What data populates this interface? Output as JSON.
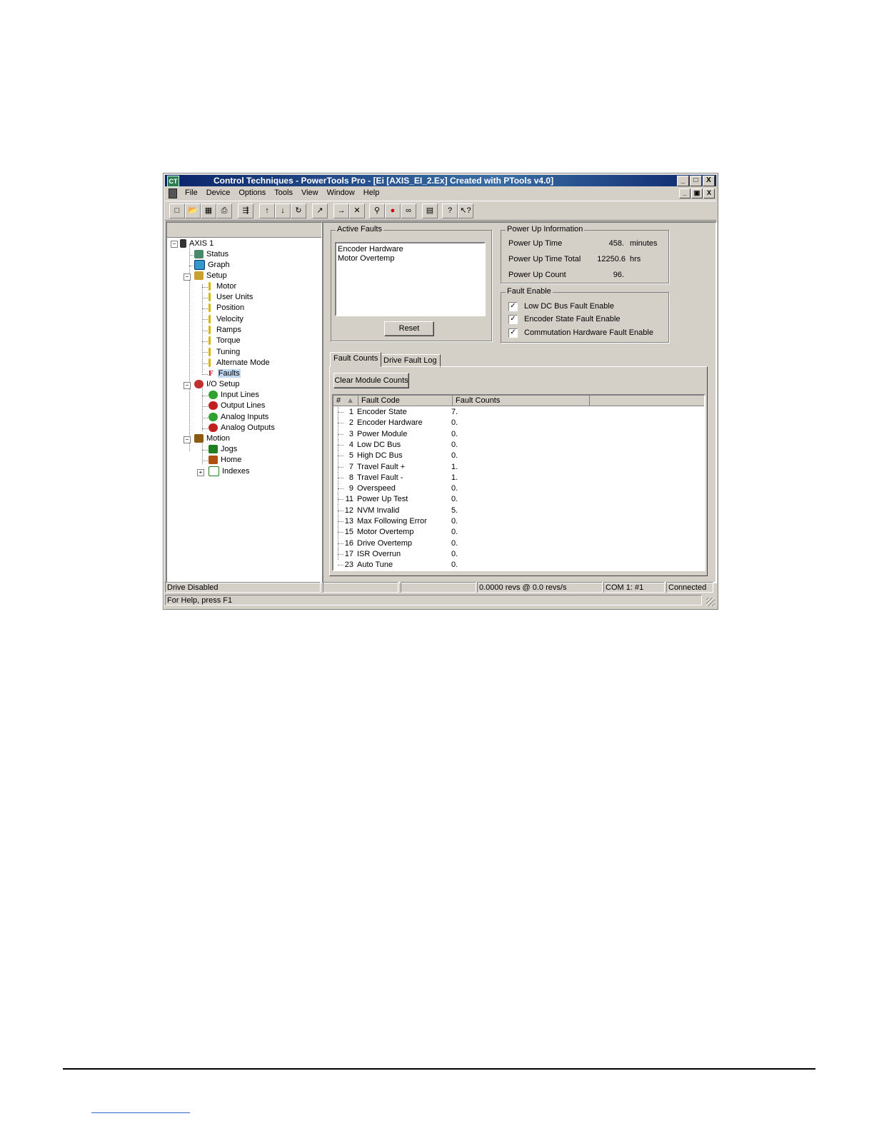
{
  "window": {
    "title": "Control Techniques - PowerTools Pro - [Ei  [AXIS_EI_2.Ex] Created with PTools v4.0]",
    "caption_buttons": [
      "_",
      "□",
      "X"
    ],
    "mdi_buttons": [
      "_",
      "▣",
      "X"
    ]
  },
  "menu": [
    "File",
    "Device",
    "Options",
    "Tools",
    "View",
    "Window",
    "Help"
  ],
  "toolbar_icons": [
    "new-icon",
    "open-icon",
    "save-icon",
    "print-icon",
    "export-icon",
    "upload-icon",
    "download-icon",
    "refresh-icon",
    "connect-icon",
    "transfer-icon",
    "disconnect-icon",
    "search-icon",
    "stop-icon",
    "view-icon",
    "window-icon",
    "help-icon",
    "context-help-icon"
  ],
  "tree": {
    "root": "AXIS 1",
    "items": [
      {
        "label": "Status"
      },
      {
        "label": "Graph"
      },
      {
        "label": "Setup"
      },
      {
        "label": "Motor"
      },
      {
        "label": "User Units"
      },
      {
        "label": "Position"
      },
      {
        "label": "Velocity"
      },
      {
        "label": "Ramps"
      },
      {
        "label": "Torque"
      },
      {
        "label": "Tuning"
      },
      {
        "label": "Alternate Mode"
      },
      {
        "label": "Faults"
      },
      {
        "label": "I/O Setup"
      },
      {
        "label": "Input Lines"
      },
      {
        "label": "Output Lines"
      },
      {
        "label": "Analog Inputs"
      },
      {
        "label": "Analog Outputs"
      },
      {
        "label": "Motion"
      },
      {
        "label": "Jogs"
      },
      {
        "label": "Home"
      },
      {
        "label": "Indexes"
      }
    ]
  },
  "active_faults": {
    "legend": "Active Faults",
    "items": [
      "Encoder Hardware",
      "Motor Overtemp"
    ],
    "reset_label": "Reset"
  },
  "power_up": {
    "legend": "Power Up Information",
    "rows": [
      {
        "label": "Power Up Time",
        "value": "458.",
        "unit": "minutes"
      },
      {
        "label": "Power Up Time Total",
        "value": "12250.6",
        "unit": "hrs"
      },
      {
        "label": "Power Up Count",
        "value": "96.",
        "unit": ""
      }
    ]
  },
  "fault_enable": {
    "legend": "Fault Enable",
    "items": [
      {
        "label": "Low DC Bus Fault Enable",
        "checked": "✓"
      },
      {
        "label": "Encoder State Fault Enable",
        "checked": "✓"
      },
      {
        "label": "Commutation Hardware Fault Enable",
        "checked": "✓"
      }
    ]
  },
  "tabs": [
    "Fault Counts",
    "Drive Fault Log"
  ],
  "clear_label": "Clear Module Counts",
  "grid": {
    "headers": [
      "#",
      "Fault Code",
      "Fault Counts"
    ],
    "rows": [
      {
        "num": "1",
        "code": "Encoder State",
        "count": "7."
      },
      {
        "num": "2",
        "code": "Encoder Hardware",
        "count": "0."
      },
      {
        "num": "3",
        "code": "Power Module",
        "count": "0."
      },
      {
        "num": "4",
        "code": "Low DC Bus",
        "count": "0."
      },
      {
        "num": "5",
        "code": "High DC Bus",
        "count": "0."
      },
      {
        "num": "7",
        "code": "Travel Fault +",
        "count": "1."
      },
      {
        "num": "8",
        "code": "Travel Fault -",
        "count": "1."
      },
      {
        "num": "9",
        "code": "Overspeed",
        "count": "0."
      },
      {
        "num": "11",
        "code": "Power Up Test",
        "count": "0."
      },
      {
        "num": "12",
        "code": "NVM Invalid",
        "count": "5."
      },
      {
        "num": "13",
        "code": "Max Following Error",
        "count": "0."
      },
      {
        "num": "15",
        "code": "Motor Overtemp",
        "count": "0."
      },
      {
        "num": "16",
        "code": "Drive Overtemp",
        "count": "0."
      },
      {
        "num": "17",
        "code": "ISR Overrun",
        "count": "0."
      },
      {
        "num": "23",
        "code": "Auto Tune",
        "count": "0."
      }
    ]
  },
  "status": {
    "drive": "Drive Disabled",
    "position": "0.0000 revs @ 0.0 revs/s",
    "port": "COM 1: #1",
    "connection": "Connected",
    "help": "For Help, press F1"
  },
  "colors": {
    "title_bar": "#0a246a",
    "face": "#d4d0c8",
    "selection": "#c0d8f0",
    "fault_red": "#cc0000"
  }
}
